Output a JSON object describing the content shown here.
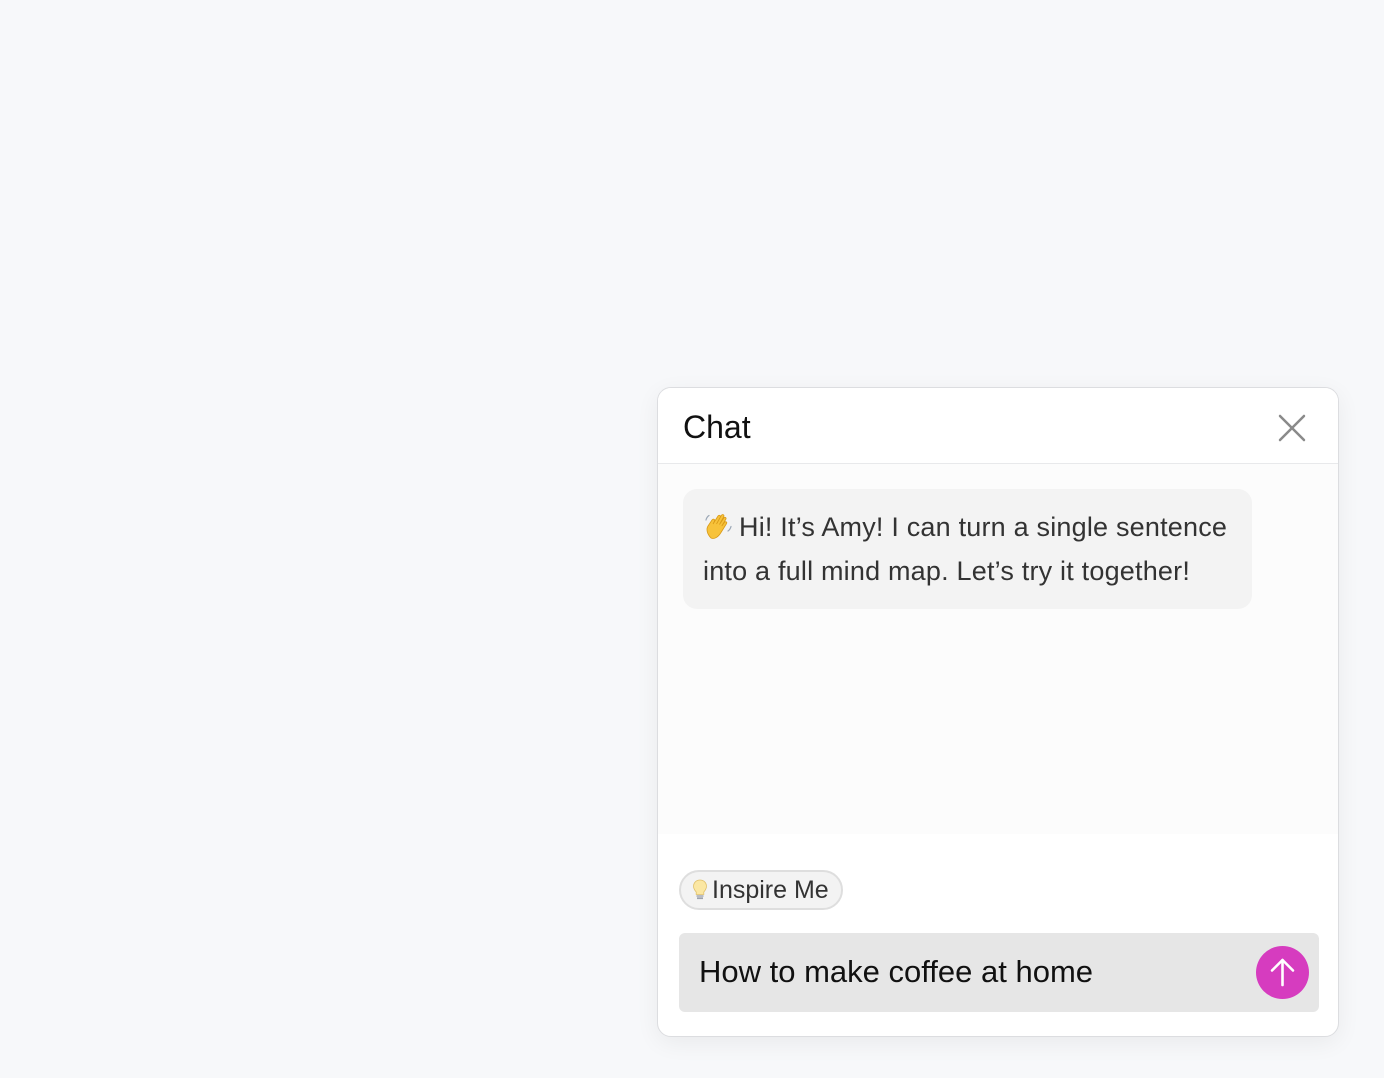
{
  "chat": {
    "title": "Chat",
    "close_icon": "close-icon",
    "messages": [
      {
        "sender": "assistant",
        "icon": "waving-hand-icon",
        "text": "Hi! It’s Amy! I can turn a single sentence into a full mind map. Let’s try it together!"
      }
    ],
    "inspire": {
      "icon": "lightbulb-icon",
      "label": "Inspire Me"
    },
    "input": {
      "value": "How to make coffee at home"
    },
    "send": {
      "icon": "arrow-up-icon",
      "color": "#d63cbf"
    }
  }
}
